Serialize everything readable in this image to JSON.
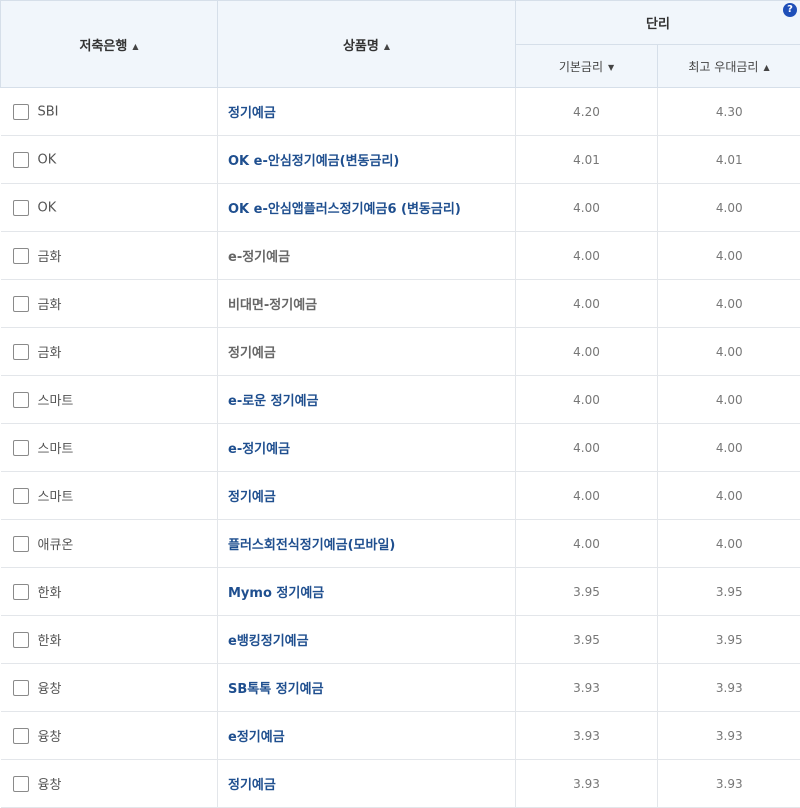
{
  "headers": {
    "bank": "저축은행",
    "product": "상품명",
    "simple_interest": "단리",
    "base_rate": "기본금리",
    "max_rate": "최고 우대금리",
    "help_icon": "?"
  },
  "sort_icons": {
    "bank": "▲",
    "product": "▲",
    "base_rate": "▼",
    "max_rate": "▲"
  },
  "rows": [
    {
      "bank": "SBI",
      "product": "정기예금",
      "base": "4.20",
      "max": "4.30",
      "link": true
    },
    {
      "bank": "OK",
      "product": "OK e-안심정기예금(변동금리)",
      "base": "4.01",
      "max": "4.01",
      "link": true
    },
    {
      "bank": "OK",
      "product": "OK e-안심앱플러스정기예금6 (변동금리)",
      "base": "4.00",
      "max": "4.00",
      "link": true
    },
    {
      "bank": "금화",
      "product": "e-정기예금",
      "base": "4.00",
      "max": "4.00",
      "link": false
    },
    {
      "bank": "금화",
      "product": "비대면-정기예금",
      "base": "4.00",
      "max": "4.00",
      "link": false
    },
    {
      "bank": "금화",
      "product": "정기예금",
      "base": "4.00",
      "max": "4.00",
      "link": false
    },
    {
      "bank": "스마트",
      "product": "e-로운 정기예금",
      "base": "4.00",
      "max": "4.00",
      "link": true
    },
    {
      "bank": "스마트",
      "product": "e-정기예금",
      "base": "4.00",
      "max": "4.00",
      "link": true
    },
    {
      "bank": "스마트",
      "product": "정기예금",
      "base": "4.00",
      "max": "4.00",
      "link": true
    },
    {
      "bank": "애큐온",
      "product": "플러스회전식정기예금(모바일)",
      "base": "4.00",
      "max": "4.00",
      "link": true
    },
    {
      "bank": "한화",
      "product": "Mymo 정기예금",
      "base": "3.95",
      "max": "3.95",
      "link": true
    },
    {
      "bank": "한화",
      "product": "e뱅킹정기예금",
      "base": "3.95",
      "max": "3.95",
      "link": true
    },
    {
      "bank": "융창",
      "product": "SB톡톡 정기예금",
      "base": "3.93",
      "max": "3.93",
      "link": true
    },
    {
      "bank": "융창",
      "product": "e정기예금",
      "base": "3.93",
      "max": "3.93",
      "link": true
    },
    {
      "bank": "융창",
      "product": "정기예금",
      "base": "3.93",
      "max": "3.93",
      "link": true
    }
  ],
  "colors": {
    "header_bg": "#f1f6fb",
    "link_text": "#1f4f8f",
    "help_icon_bg": "#1f4fb8"
  }
}
